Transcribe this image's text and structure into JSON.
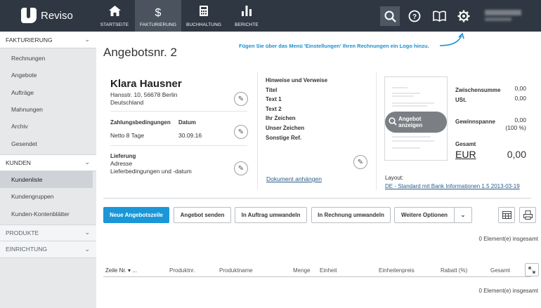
{
  "app": {
    "name": "Reviso"
  },
  "nav": [
    {
      "label": "STARTSEITE",
      "icon": "home-icon",
      "glyph": "⌂"
    },
    {
      "label": "FAKTURIERUNG",
      "icon": "dollar-icon",
      "glyph": "$"
    },
    {
      "label": "BUCHHALTUNG",
      "icon": "calculator-icon",
      "glyph": "▦"
    },
    {
      "label": "BERICHTE",
      "icon": "bar-chart-icon",
      "glyph": "▮"
    }
  ],
  "sidebar": {
    "sections": [
      {
        "label": "FAKTURIERUNG",
        "items": [
          "Rechnungen",
          "Angebote",
          "Aufträge",
          "Mahnungen",
          "Archiv",
          "Gesendet"
        ]
      },
      {
        "label": "KUNDEN",
        "items": [
          "Kundenliste",
          "Kundengruppen",
          "Kunden-Kontenblätter"
        ]
      },
      {
        "label": "PRODUKTE",
        "items": []
      },
      {
        "label": "EINRICHTUNG",
        "items": []
      }
    ]
  },
  "main": {
    "title": "Angebotsnr. 2",
    "hint": "Fügen Sie über das Menü 'Einstellungen' Ihren Rechnungen ein Logo hinzu.",
    "customer": {
      "name": "Klara Hausner",
      "street": "Hansstr. 10, 56678 Berlin",
      "country": "Deutschland"
    },
    "payment_label": "Zahlungsbedingungen",
    "payment_value": "Netto 8 Tage",
    "date_label": "Datum",
    "date_value": "30.09.16",
    "delivery_label": "Lieferung",
    "delivery_address": "Adresse",
    "delivery_terms": "Lieferbedingungen und -datum",
    "references": [
      "Hinweise und Verweise",
      "Titel",
      "Text 1",
      "Text 2",
      "Ihr Zeichen",
      "Unser Zeichen",
      "Sonstige Ref."
    ],
    "attach_link": "Dokument anhängen",
    "preview_button": "Angebot anzeigen",
    "layout_label": "Layout:",
    "layout_value": "DE - Standard mit Bank Informationen 1.5 2013-03-19",
    "totals": {
      "subtotal_label": "Zwischensumme",
      "subtotal_value": "0,00",
      "vat_label": "USt.",
      "vat_value": "0,00",
      "margin_label": "Gewinnspanne",
      "margin_value": "0,00",
      "margin_pct": "(100 %)",
      "total_label": "Gesamt",
      "currency": "EUR",
      "total_value": "0,00"
    },
    "buttons": {
      "new_line": "Neue Angebotszeile",
      "send": "Angebot senden",
      "to_order": "In Auftrag umwandeln",
      "to_invoice": "In Rechnung umwandeln",
      "more": "Weitere Optionen"
    },
    "count_text": "0 Element(e) insgesamt",
    "columns": [
      "Zeile Nr.",
      "...",
      "Produktnr.",
      "Produktname",
      "Menge",
      "Einheit",
      "Einheitenpreis",
      "Rabatt (%)",
      "Gesamt"
    ]
  }
}
